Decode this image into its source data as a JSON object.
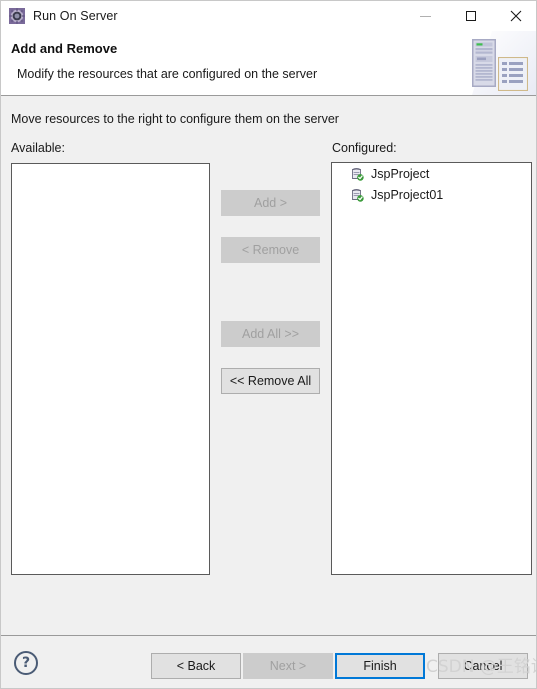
{
  "window": {
    "title": "Run On Server",
    "icon": "run-on-server-icon",
    "controls": {
      "minimize": "—",
      "maximize": "□",
      "close": "✕"
    }
  },
  "header": {
    "title": "Add and Remove",
    "description": "Modify the resources that are configured on the server",
    "graphic": "server-and-document-icon"
  },
  "body": {
    "instruction": "Move resources to the right to configure them on the server",
    "available": {
      "label": "Available:",
      "items": []
    },
    "configured": {
      "label": "Configured:",
      "items": [
        {
          "label": "JspProject",
          "icon": "web-module-icon"
        },
        {
          "label": "JspProject01",
          "icon": "web-module-icon"
        }
      ]
    },
    "transfer_buttons": [
      {
        "label": "Add >",
        "enabled": false,
        "name": "add-button"
      },
      {
        "label": "< Remove",
        "enabled": false,
        "name": "remove-button"
      },
      {
        "label": "Add All >>",
        "enabled": false,
        "name": "add-all-button"
      },
      {
        "label": "<< Remove All",
        "enabled": true,
        "name": "remove-all-button"
      }
    ]
  },
  "footer": {
    "help": "?",
    "buttons": {
      "back": "< Back",
      "next": "Next >",
      "finish": "Finish",
      "cancel": "Cancel"
    }
  },
  "watermark": "CSDN @王铭诗",
  "colors": {
    "accent": "#0078d7",
    "dialog_bg": "#f0f0f0",
    "header_bg": "#ffffff",
    "button_bg": "#e1e1e1",
    "button_disabled_bg": "#cccccc",
    "text": "#1a1a1a",
    "text_disabled": "#a0a0a0",
    "help_icon": "#4a5b75"
  }
}
